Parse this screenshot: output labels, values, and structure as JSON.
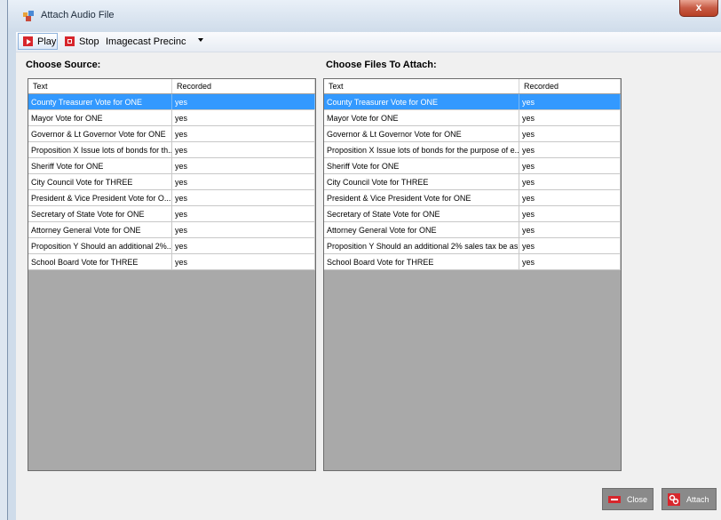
{
  "window": {
    "title": "Attach Audio File",
    "close_glyph": "x"
  },
  "toolbar": {
    "play_label": "Play",
    "stop_label": "Stop",
    "precinct_value": "Imagecast Precinc"
  },
  "source": {
    "heading": "Choose Source:",
    "columns": [
      "Text",
      "Recorded"
    ],
    "rows": [
      [
        "County Treasurer Vote for ONE",
        "yes"
      ],
      [
        "Mayor Vote for ONE",
        "yes"
      ],
      [
        "Governor & Lt Governor Vote for ONE",
        "yes"
      ],
      [
        "Proposition X Issue lots of bonds for th...",
        "yes"
      ],
      [
        "Sheriff Vote for ONE",
        "yes"
      ],
      [
        "City Council Vote for THREE",
        "yes"
      ],
      [
        "President & Vice President Vote for O...",
        "yes"
      ],
      [
        "Secretary of State Vote for ONE",
        "yes"
      ],
      [
        "Attorney General Vote for ONE",
        "yes"
      ],
      [
        "Proposition Y Should an additional 2%...",
        "yes"
      ],
      [
        "School Board Vote for THREE",
        "yes"
      ]
    ]
  },
  "attach": {
    "heading": "Choose Files To Attach:",
    "columns": [
      "Text",
      "Recorded"
    ],
    "rows": [
      [
        "County Treasurer Vote for ONE",
        "yes"
      ],
      [
        "Mayor Vote for ONE",
        "yes"
      ],
      [
        "Governor & Lt Governor Vote for ONE",
        "yes"
      ],
      [
        "Proposition X Issue lots of bonds for the purpose of e...",
        "yes"
      ],
      [
        "Sheriff Vote for ONE",
        "yes"
      ],
      [
        "City Council Vote for THREE",
        "yes"
      ],
      [
        "President & Vice President Vote for ONE",
        "yes"
      ],
      [
        "Secretary of State Vote for ONE",
        "yes"
      ],
      [
        "Attorney General Vote for ONE",
        "yes"
      ],
      [
        "Proposition Y Should an additional 2% sales tax be as...",
        "yes"
      ],
      [
        "School Board Vote for THREE",
        "yes"
      ]
    ]
  },
  "buttons": {
    "close_label": "Close",
    "attach_label": "Attach"
  },
  "colors": {
    "selection": "#3399ff",
    "grid_empty": "#a9a9a9",
    "accent_red": "#d7262c"
  },
  "icons": [
    "app-icon",
    "play-icon",
    "stop-icon",
    "dropdown-arrow-icon",
    "close-icon",
    "attach-icon"
  ]
}
